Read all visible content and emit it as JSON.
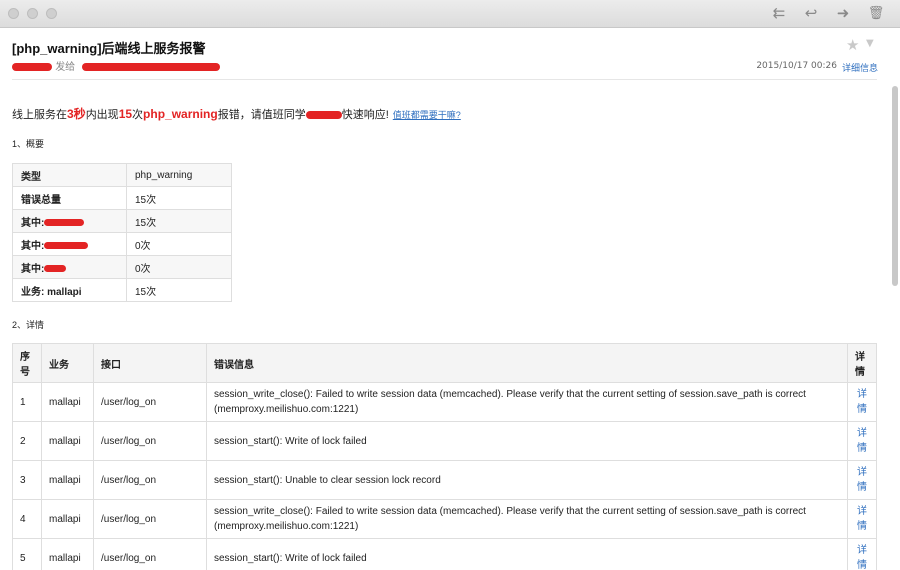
{
  "toolbar": {
    "reply_all": "⇇",
    "reply": "↩",
    "forward": "➜",
    "trash": "🗑"
  },
  "header": {
    "subject": "[php_warning]后端线上服务报警",
    "sender_suffix": "发给",
    "date": "2015/10/17  00:26",
    "details_link": "详细信息"
  },
  "body": {
    "intro_1": "线上服务在",
    "intro_em1": "3秒",
    "intro_2": "内出现",
    "intro_em2": "15",
    "intro_3": "次",
    "intro_em3": "php_warning",
    "intro_4": "报错，请值班同学",
    "intro_5": "快速响应!",
    "help_link": "值班都需要干嘛?",
    "section1": "1、概要",
    "section2": "2、详情"
  },
  "summary": [
    {
      "key": "类型",
      "value": "php_warning"
    },
    {
      "key": "错误总量",
      "value": "15次"
    },
    {
      "key": "其中:",
      "value": "15次"
    },
    {
      "key": "其中:",
      "value": "0次"
    },
    {
      "key": "其中:",
      "value": "0次"
    },
    {
      "key": "业务: mallapi",
      "value": "15次"
    }
  ],
  "detail": {
    "headers": {
      "seq": "序号",
      "biz": "业务",
      "api": "接口",
      "msg": "错误信息",
      "more": "详情"
    },
    "rows": [
      {
        "seq": "1",
        "biz": "mallapi",
        "api": "/user/log_on",
        "msg": "session_write_close(): Failed to write session data (memcached). Please verify that the current setting of session.save_path is correct (memproxy.meilishuo.com:1221)",
        "more": "详情"
      },
      {
        "seq": "2",
        "biz": "mallapi",
        "api": "/user/log_on",
        "msg": "session_start(): Write of lock failed",
        "more": "详情"
      },
      {
        "seq": "3",
        "biz": "mallapi",
        "api": "/user/log_on",
        "msg": "session_start(): Unable to clear session lock record",
        "more": "详情"
      },
      {
        "seq": "4",
        "biz": "mallapi",
        "api": "/user/log_on",
        "msg": "session_write_close(): Failed to write session data (memcached). Please verify that the current setting of session.save_path is correct (memproxy.meilishuo.com:1221)",
        "more": "详情"
      },
      {
        "seq": "5",
        "biz": "mallapi",
        "api": "/user/log_on",
        "msg": "session_start(): Write of lock failed",
        "more": "详情"
      }
    ]
  },
  "colors": {
    "accent_red": "#e32424",
    "link_blue": "#2f6fbf"
  }
}
